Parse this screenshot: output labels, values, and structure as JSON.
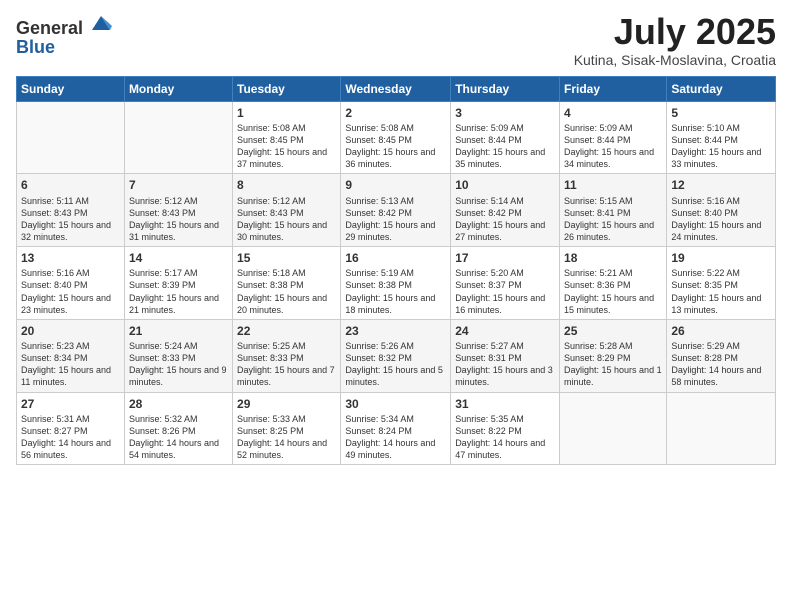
{
  "header": {
    "logo_line1": "General",
    "logo_line2": "Blue",
    "month": "July 2025",
    "location": "Kutina, Sisak-Moslavina, Croatia"
  },
  "days_of_week": [
    "Sunday",
    "Monday",
    "Tuesday",
    "Wednesday",
    "Thursday",
    "Friday",
    "Saturday"
  ],
  "weeks": [
    [
      {
        "day": "",
        "info": ""
      },
      {
        "day": "",
        "info": ""
      },
      {
        "day": "1",
        "info": "Sunrise: 5:08 AM\nSunset: 8:45 PM\nDaylight: 15 hours and 37 minutes."
      },
      {
        "day": "2",
        "info": "Sunrise: 5:08 AM\nSunset: 8:45 PM\nDaylight: 15 hours and 36 minutes."
      },
      {
        "day": "3",
        "info": "Sunrise: 5:09 AM\nSunset: 8:44 PM\nDaylight: 15 hours and 35 minutes."
      },
      {
        "day": "4",
        "info": "Sunrise: 5:09 AM\nSunset: 8:44 PM\nDaylight: 15 hours and 34 minutes."
      },
      {
        "day": "5",
        "info": "Sunrise: 5:10 AM\nSunset: 8:44 PM\nDaylight: 15 hours and 33 minutes."
      }
    ],
    [
      {
        "day": "6",
        "info": "Sunrise: 5:11 AM\nSunset: 8:43 PM\nDaylight: 15 hours and 32 minutes."
      },
      {
        "day": "7",
        "info": "Sunrise: 5:12 AM\nSunset: 8:43 PM\nDaylight: 15 hours and 31 minutes."
      },
      {
        "day": "8",
        "info": "Sunrise: 5:12 AM\nSunset: 8:43 PM\nDaylight: 15 hours and 30 minutes."
      },
      {
        "day": "9",
        "info": "Sunrise: 5:13 AM\nSunset: 8:42 PM\nDaylight: 15 hours and 29 minutes."
      },
      {
        "day": "10",
        "info": "Sunrise: 5:14 AM\nSunset: 8:42 PM\nDaylight: 15 hours and 27 minutes."
      },
      {
        "day": "11",
        "info": "Sunrise: 5:15 AM\nSunset: 8:41 PM\nDaylight: 15 hours and 26 minutes."
      },
      {
        "day": "12",
        "info": "Sunrise: 5:16 AM\nSunset: 8:40 PM\nDaylight: 15 hours and 24 minutes."
      }
    ],
    [
      {
        "day": "13",
        "info": "Sunrise: 5:16 AM\nSunset: 8:40 PM\nDaylight: 15 hours and 23 minutes."
      },
      {
        "day": "14",
        "info": "Sunrise: 5:17 AM\nSunset: 8:39 PM\nDaylight: 15 hours and 21 minutes."
      },
      {
        "day": "15",
        "info": "Sunrise: 5:18 AM\nSunset: 8:38 PM\nDaylight: 15 hours and 20 minutes."
      },
      {
        "day": "16",
        "info": "Sunrise: 5:19 AM\nSunset: 8:38 PM\nDaylight: 15 hours and 18 minutes."
      },
      {
        "day": "17",
        "info": "Sunrise: 5:20 AM\nSunset: 8:37 PM\nDaylight: 15 hours and 16 minutes."
      },
      {
        "day": "18",
        "info": "Sunrise: 5:21 AM\nSunset: 8:36 PM\nDaylight: 15 hours and 15 minutes."
      },
      {
        "day": "19",
        "info": "Sunrise: 5:22 AM\nSunset: 8:35 PM\nDaylight: 15 hours and 13 minutes."
      }
    ],
    [
      {
        "day": "20",
        "info": "Sunrise: 5:23 AM\nSunset: 8:34 PM\nDaylight: 15 hours and 11 minutes."
      },
      {
        "day": "21",
        "info": "Sunrise: 5:24 AM\nSunset: 8:33 PM\nDaylight: 15 hours and 9 minutes."
      },
      {
        "day": "22",
        "info": "Sunrise: 5:25 AM\nSunset: 8:33 PM\nDaylight: 15 hours and 7 minutes."
      },
      {
        "day": "23",
        "info": "Sunrise: 5:26 AM\nSunset: 8:32 PM\nDaylight: 15 hours and 5 minutes."
      },
      {
        "day": "24",
        "info": "Sunrise: 5:27 AM\nSunset: 8:31 PM\nDaylight: 15 hours and 3 minutes."
      },
      {
        "day": "25",
        "info": "Sunrise: 5:28 AM\nSunset: 8:29 PM\nDaylight: 15 hours and 1 minute."
      },
      {
        "day": "26",
        "info": "Sunrise: 5:29 AM\nSunset: 8:28 PM\nDaylight: 14 hours and 58 minutes."
      }
    ],
    [
      {
        "day": "27",
        "info": "Sunrise: 5:31 AM\nSunset: 8:27 PM\nDaylight: 14 hours and 56 minutes."
      },
      {
        "day": "28",
        "info": "Sunrise: 5:32 AM\nSunset: 8:26 PM\nDaylight: 14 hours and 54 minutes."
      },
      {
        "day": "29",
        "info": "Sunrise: 5:33 AM\nSunset: 8:25 PM\nDaylight: 14 hours and 52 minutes."
      },
      {
        "day": "30",
        "info": "Sunrise: 5:34 AM\nSunset: 8:24 PM\nDaylight: 14 hours and 49 minutes."
      },
      {
        "day": "31",
        "info": "Sunrise: 5:35 AM\nSunset: 8:22 PM\nDaylight: 14 hours and 47 minutes."
      },
      {
        "day": "",
        "info": ""
      },
      {
        "day": "",
        "info": ""
      }
    ]
  ]
}
